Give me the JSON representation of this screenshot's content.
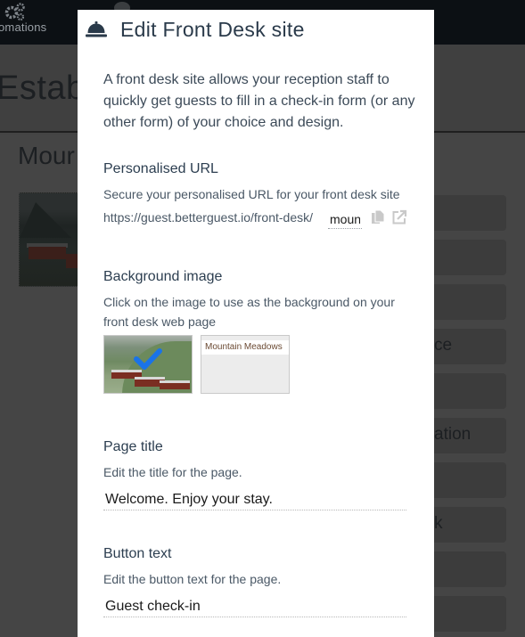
{
  "background": {
    "nav": {
      "automations_label": "omations",
      "automations_icon": "gears-icon"
    },
    "page_title": "Establi",
    "property_name": "Mour",
    "cards": [
      {
        "label": ""
      },
      {
        "label": ""
      },
      {
        "label": ""
      },
      {
        "label": "ce"
      },
      {
        "label": ""
      },
      {
        "label": "ation"
      },
      {
        "label": ""
      },
      {
        "label": "k"
      },
      {
        "label": ""
      },
      {
        "label": ""
      }
    ]
  },
  "modal": {
    "icon": "reception-bell-icon",
    "title": "Edit Front Desk site",
    "intro": "A front desk site allows your reception staff to quickly get guests to fill in a check-in form (or any other form) of your choice and design.",
    "url_section": {
      "label": "Personalised URL",
      "help": "Secure your personalised URL for your front desk site",
      "prefix": "https://guest.betterguest.io/front-desk/",
      "slug": "mountain-meadows",
      "copy_icon": "copy-icon",
      "open_icon": "external-link-icon"
    },
    "background_section": {
      "label": "Background image",
      "help": "Click on the image to use as the background on your front desk web page",
      "options": [
        {
          "name": "cabins-photo",
          "selected": true
        },
        {
          "name": "plain",
          "title": "Mountain Meadows",
          "selected": false
        }
      ],
      "accent_color": "#1a73e8"
    },
    "page_title_section": {
      "label": "Page title",
      "help": "Edit the title for the page.",
      "value": "Welcome. Enjoy your stay."
    },
    "button_text_section": {
      "label": "Button text",
      "help": "Edit the button text for the page.",
      "value": "Guest check-in"
    }
  }
}
